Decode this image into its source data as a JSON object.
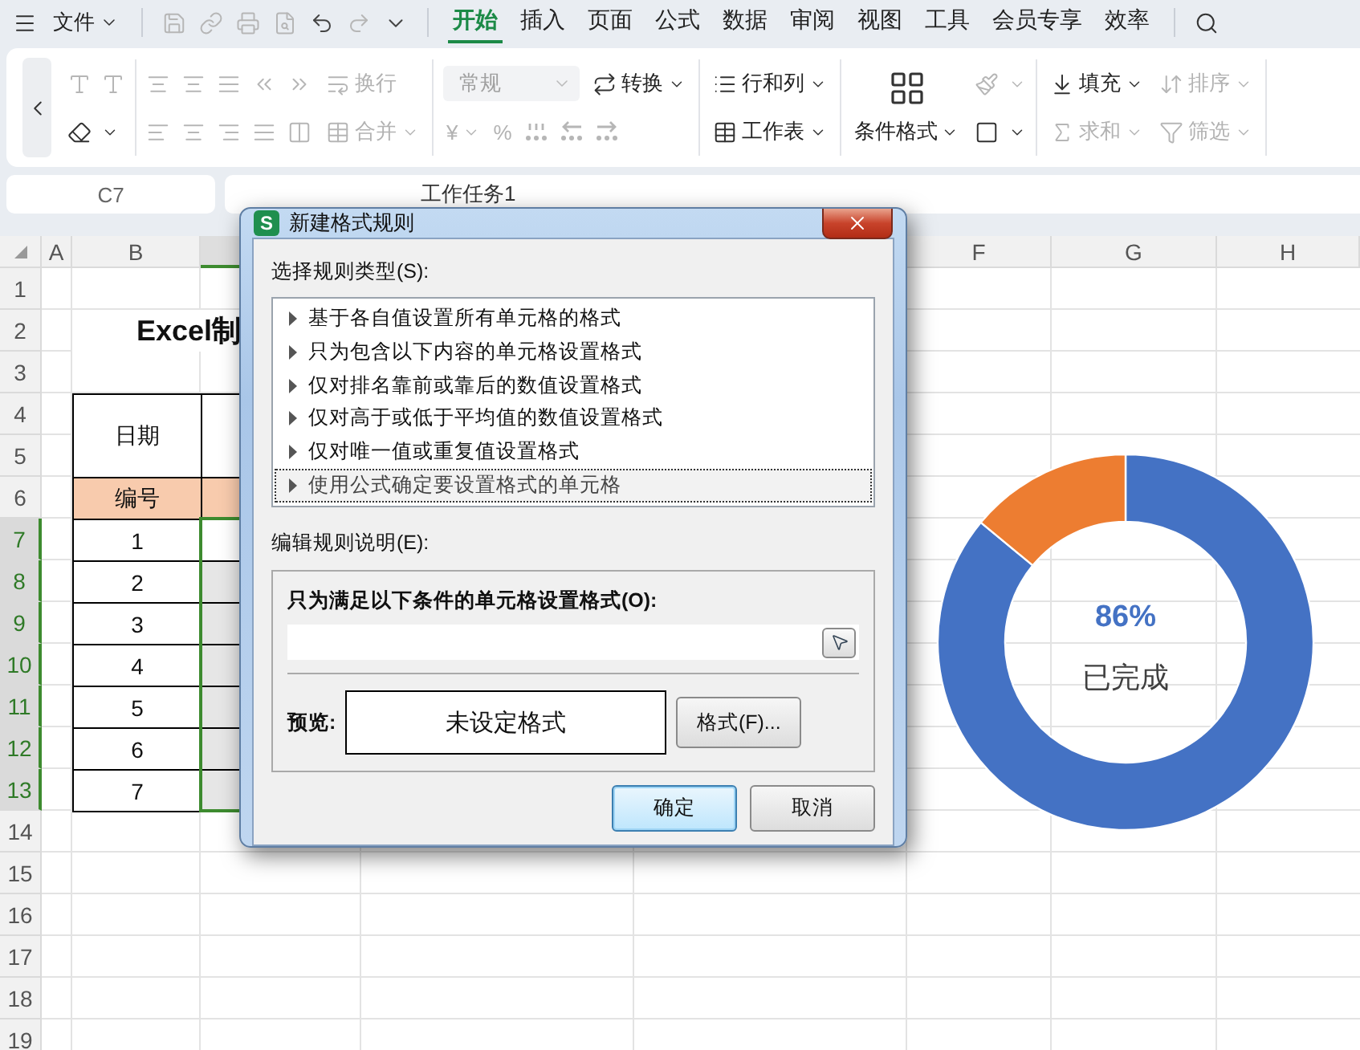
{
  "menu_bar": {
    "file_menu": "文件",
    "tabs": [
      {
        "label": "开始",
        "selected": true
      },
      {
        "label": "插入",
        "selected": false
      },
      {
        "label": "页面",
        "selected": false
      },
      {
        "label": "公式",
        "selected": false
      },
      {
        "label": "数据",
        "selected": false
      },
      {
        "label": "审阅",
        "selected": false
      },
      {
        "label": "视图",
        "selected": false
      },
      {
        "label": "工具",
        "selected": false
      },
      {
        "label": "会员专享",
        "selected": false
      },
      {
        "label": "效率",
        "selected": false
      }
    ]
  },
  "ribbon": {
    "wrap_text": {
      "label": "换行",
      "disabled": true
    },
    "merge": {
      "label": "合并",
      "disabled": true
    },
    "number_format": {
      "value": "常规",
      "disabled": true
    },
    "convert": {
      "label": "转换",
      "disabled": false
    },
    "currency": {
      "label": "¥",
      "disabled": true
    },
    "percent": {
      "label": "%",
      "disabled": true
    },
    "rows_columns": {
      "label": "行和列",
      "disabled": false
    },
    "worksheet": {
      "label": "工作表",
      "disabled": false
    },
    "conditional_format": {
      "label": "条件格式",
      "disabled": false
    },
    "fill": {
      "label": "填充",
      "disabled": false
    },
    "sort": {
      "label": "排序",
      "disabled": true
    },
    "sum": {
      "label": "求和",
      "disabled": true
    },
    "filter": {
      "label": "筛选",
      "disabled": true
    }
  },
  "formula_bar": {
    "cell_reference": "C7",
    "formula": "工作任务1"
  },
  "sheet": {
    "columns": [
      {
        "label": "A",
        "selected": false
      },
      {
        "label": "B",
        "selected": false
      },
      {
        "selected": true
      },
      {
        "label": "F",
        "selected": false
      },
      {
        "label": "G",
        "selected": false
      },
      {
        "label": "H",
        "selected": false
      }
    ],
    "rows": [
      {
        "label": "1",
        "selected": false
      },
      {
        "label": "2",
        "selected": false
      },
      {
        "label": "3",
        "selected": false
      },
      {
        "label": "4",
        "selected": false
      },
      {
        "label": "5",
        "selected": false
      },
      {
        "label": "6",
        "selected": false
      },
      {
        "label": "7",
        "selected": true
      },
      {
        "label": "8",
        "selected": true
      },
      {
        "label": "9",
        "selected": true
      },
      {
        "label": "10",
        "selected": true
      },
      {
        "label": "11",
        "selected": true
      },
      {
        "label": "12",
        "selected": true
      },
      {
        "label": "13",
        "selected": true
      },
      {
        "label": "14",
        "selected": false
      },
      {
        "label": "15",
        "selected": false
      },
      {
        "label": "16",
        "selected": false
      },
      {
        "label": "17",
        "selected": false
      },
      {
        "label": "18",
        "selected": false
      },
      {
        "label": "19",
        "selected": false
      }
    ],
    "title": "Excel制",
    "date_header": "日期",
    "number_header": "编号",
    "numbers": [
      "1",
      "2",
      "3",
      "4",
      "5",
      "6",
      "7"
    ]
  },
  "chart": {
    "chart_data": {
      "type": "donut",
      "values": [
        86,
        14
      ]
    },
    "center_value": "86%",
    "center_label": "已完成"
  },
  "dialog": {
    "app_icon_letter": "S",
    "title": "新建格式规则",
    "rule_type_label": "选择规则类型(S):",
    "rule_types": [
      {
        "label": "基于各自值设置所有单元格的格式",
        "selected": false
      },
      {
        "label": "只为包含以下内容的单元格设置格式",
        "selected": false
      },
      {
        "label": "仅对排名靠前或靠后的数值设置格式",
        "selected": false
      },
      {
        "label": "仅对高于或低于平均值的数值设置格式",
        "selected": false
      },
      {
        "label": "仅对唯一值或重复值设置格式",
        "selected": false
      },
      {
        "label": "使用公式确定要设置格式的单元格",
        "selected": true
      }
    ],
    "description_label": "编辑规则说明(E):",
    "condition_label": "只为满足以下条件的单元格设置格式(O):",
    "preview_label": "预览:",
    "preview_text": "未设定格式",
    "format_button": "格式(F)...",
    "buttons": [
      {
        "label": "确定",
        "focused": true
      },
      {
        "label": "取消",
        "focused": false
      }
    ]
  }
}
